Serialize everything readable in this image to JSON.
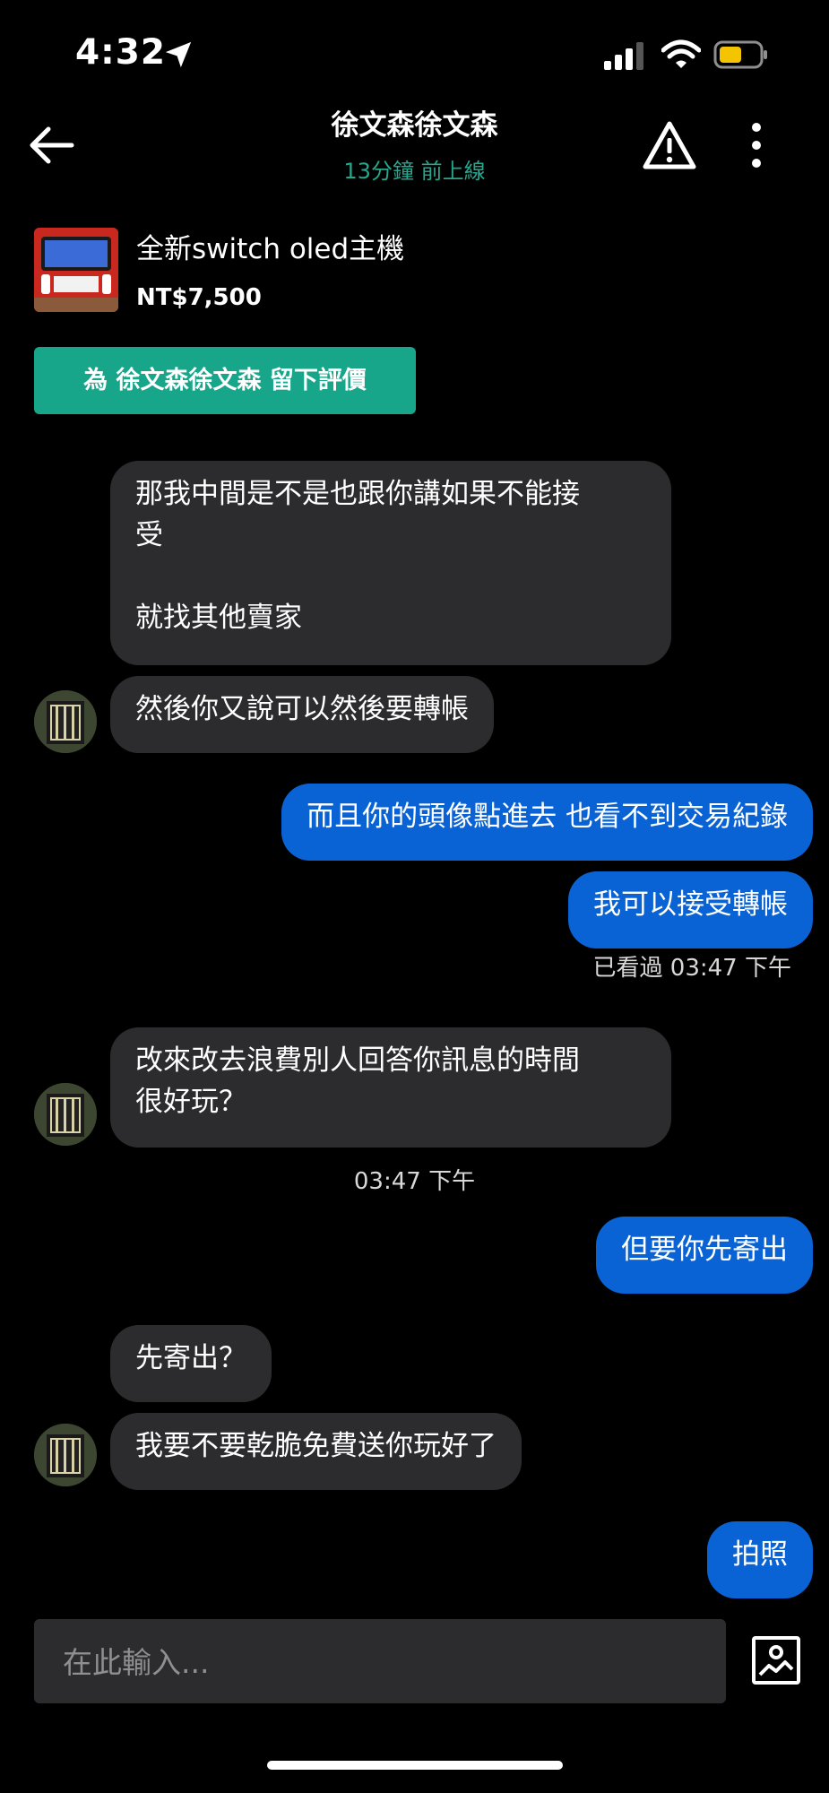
{
  "status_bar": {
    "time": "4:32"
  },
  "header": {
    "title": "徐文森徐文森",
    "subtitle": "13分鐘 前上線"
  },
  "product": {
    "name": "全新switch oled主機",
    "price": "NT$7,500",
    "review_button": "為 徐文森徐文森 留下評價"
  },
  "messages": {
    "m1": "那我中間是不是也跟你講如果不能接\n受\n\n就找其他賣家",
    "m2": "然後你又說可以然後要轉帳",
    "m3": "而且你的頭像點進去 也看不到交易紀錄",
    "m4": "我可以接受轉帳",
    "m4_status": "已看過 03:47 下午",
    "m5": "改來改去浪費別人回答你訊息的時間\n很好玩？",
    "m5_time": "03:47 下午",
    "m6": "但要你先寄出",
    "m7": "先寄出？",
    "m8": "我要不要乾脆免費送你玩好了",
    "m9": "拍照"
  },
  "composer": {
    "placeholder": "在此輸入..."
  },
  "colors": {
    "accent_green": "#17a68a",
    "outgoing_bubble": "#0a63d4",
    "incoming_bubble": "#2c2c2e",
    "online_text": "#27a68e"
  },
  "icons": [
    "location-arrow-icon",
    "cellular-signal-icon",
    "wifi-icon",
    "battery-icon",
    "back-arrow-icon",
    "warning-icon",
    "more-vertical-icon",
    "image-upload-icon"
  ]
}
